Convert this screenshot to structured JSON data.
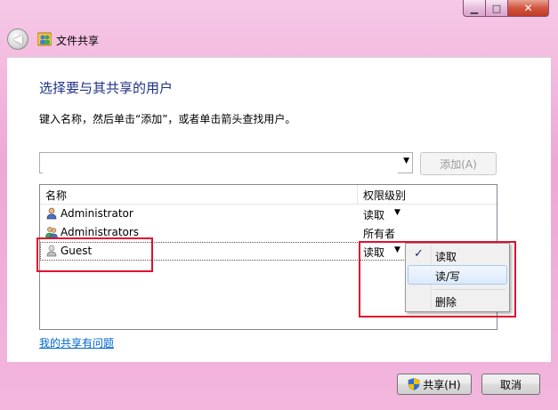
{
  "window": {
    "title": "文件共享",
    "caption": {
      "minimize": "▁",
      "maximize": "□",
      "close": "✕"
    }
  },
  "nav": {
    "back_glyph": "◀"
  },
  "main": {
    "heading": "选择要与其共享的用户",
    "instruction": "键入名称，然后单击“添加”，或者单击箭头查找用户。",
    "name_input": {
      "value": "",
      "placeholder": ""
    },
    "add_button": "添加(A)"
  },
  "list": {
    "columns": {
      "name": "名称",
      "permission": "权限级别"
    },
    "rows": [
      {
        "name": "Administrator",
        "permission": "读取",
        "has_dropdown": true,
        "icon": "user-icon"
      },
      {
        "name": "Administrators",
        "permission": "所有者",
        "has_dropdown": false,
        "icon": "group-icon"
      },
      {
        "name": "Guest",
        "permission": "读取",
        "has_dropdown": true,
        "icon": "user-icon"
      }
    ],
    "dropdown_glyph": "▼"
  },
  "menu": {
    "items": [
      {
        "label": "读取",
        "checked": true
      },
      {
        "label": "读/写",
        "checked": false
      },
      {
        "label": "删除",
        "checked": false
      }
    ],
    "check_glyph": "✓"
  },
  "help_link": "我的共享有问题",
  "footer": {
    "share": "共享(H)",
    "cancel": "取消"
  },
  "colors": {
    "heading": "#1e3287",
    "highlight": "#e0102f",
    "link": "#0066cc",
    "frame": "#eea7d6"
  }
}
